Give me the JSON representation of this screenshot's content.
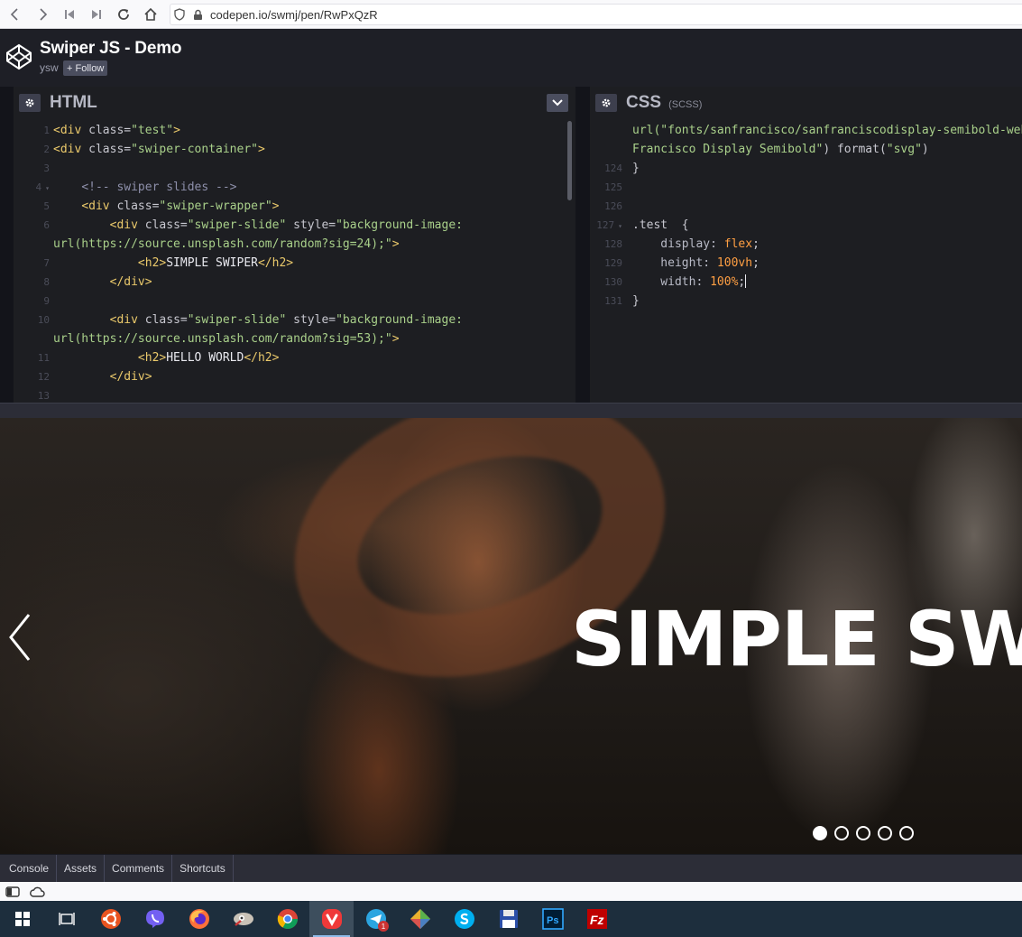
{
  "browser": {
    "url": "codepen.io/swmj/pen/RwPxQzR"
  },
  "pen": {
    "title": "Swiper JS - Demo",
    "author": "ysw",
    "follow_label": "+ Follow"
  },
  "html_editor": {
    "name": "HTML",
    "lines": [
      {
        "n": "1",
        "tokens": [
          [
            "tag",
            "<div "
          ],
          [
            "attr",
            "class="
          ],
          [
            "str",
            "\"test\""
          ],
          [
            "tag",
            ">"
          ]
        ]
      },
      {
        "n": "2",
        "tokens": [
          [
            "tag",
            "<div "
          ],
          [
            "attr",
            "class="
          ],
          [
            "str",
            "\"swiper-container\""
          ],
          [
            "tag",
            ">"
          ]
        ]
      },
      {
        "n": "3",
        "tokens": []
      },
      {
        "n": "4",
        "tokens": [
          [
            "txt",
            "    "
          ],
          [
            "com",
            "<!-- swiper slides -->"
          ]
        ]
      },
      {
        "n": "5",
        "tokens": [
          [
            "txt",
            "    "
          ],
          [
            "tag",
            "<div "
          ],
          [
            "attr",
            "class="
          ],
          [
            "str",
            "\"swiper-wrapper\""
          ],
          [
            "tag",
            ">"
          ]
        ]
      },
      {
        "n": "6",
        "tokens": [
          [
            "txt",
            "        "
          ],
          [
            "tag",
            "<div "
          ],
          [
            "attr",
            "class="
          ],
          [
            "str",
            "\"swiper-slide\""
          ],
          [
            "attr",
            " style="
          ],
          [
            "str",
            "\"background-image:"
          ]
        ]
      },
      {
        "n": "",
        "tokens": [
          [
            "str",
            "url(https://source.unsplash.com/random?sig=24);\""
          ],
          [
            "tag",
            ">"
          ]
        ]
      },
      {
        "n": "7",
        "tokens": [
          [
            "txt",
            "            "
          ],
          [
            "tag",
            "<h2>"
          ],
          [
            "txt",
            "SIMPLE SWIPER"
          ],
          [
            "tag",
            "</h2>"
          ]
        ]
      },
      {
        "n": "8",
        "tokens": [
          [
            "txt",
            "        "
          ],
          [
            "tag",
            "</div>"
          ]
        ]
      },
      {
        "n": "9",
        "tokens": []
      },
      {
        "n": "10",
        "tokens": [
          [
            "txt",
            "        "
          ],
          [
            "tag",
            "<div "
          ],
          [
            "attr",
            "class="
          ],
          [
            "str",
            "\"swiper-slide\""
          ],
          [
            "attr",
            " style="
          ],
          [
            "str",
            "\"background-image:"
          ]
        ]
      },
      {
        "n": "",
        "tokens": [
          [
            "str",
            "url(https://source.unsplash.com/random?sig=53);\""
          ],
          [
            "tag",
            ">"
          ]
        ]
      },
      {
        "n": "11",
        "tokens": [
          [
            "txt",
            "            "
          ],
          [
            "tag",
            "<h2>"
          ],
          [
            "txt",
            "HELLO WORLD"
          ],
          [
            "tag",
            "</h2>"
          ]
        ]
      },
      {
        "n": "12",
        "tokens": [
          [
            "txt",
            "        "
          ],
          [
            "tag",
            "</div>"
          ]
        ]
      },
      {
        "n": "13",
        "tokens": []
      }
    ]
  },
  "css_editor": {
    "name": "CSS",
    "sub": "(SCSS)",
    "lines": [
      {
        "n": "",
        "tokens": [
          [
            "str",
            "url(\"fonts/sanfrancisco/sanfranciscodisplay-semibold-webfont.svg#San"
          ]
        ]
      },
      {
        "n": "",
        "tokens": [
          [
            "str",
            "Francisco Display Semibold\""
          ],
          [
            "fn",
            ") format("
          ],
          [
            "str",
            "\"svg\""
          ],
          [
            "fn",
            ")"
          ]
        ]
      },
      {
        "n": "124",
        "tokens": [
          [
            "fn",
            "}"
          ]
        ]
      },
      {
        "n": "125",
        "tokens": []
      },
      {
        "n": "126",
        "tokens": []
      },
      {
        "n": "127",
        "tokens": [
          [
            "fn",
            ".test  {"
          ]
        ]
      },
      {
        "n": "128",
        "tokens": [
          [
            "prop",
            "    display: "
          ],
          [
            "val",
            "flex"
          ],
          [
            "fn",
            ";"
          ]
        ]
      },
      {
        "n": "129",
        "tokens": [
          [
            "prop",
            "    height: "
          ],
          [
            "num",
            "100vh"
          ],
          [
            "fn",
            ";"
          ]
        ]
      },
      {
        "n": "130",
        "tokens": [
          [
            "prop",
            "    width: "
          ],
          [
            "num",
            "100%"
          ],
          [
            "fn",
            ";"
          ]
        ]
      },
      {
        "n": "131",
        "tokens": [
          [
            "fn",
            "}"
          ]
        ]
      }
    ]
  },
  "preview": {
    "slide_title": "SIMPLE SWIPER",
    "pagination": {
      "count": 5,
      "active_index": 0
    }
  },
  "bottom_tabs": [
    "Console",
    "Assets",
    "Comments",
    "Shortcuts"
  ],
  "taskbar": {
    "telegram_badge": "1",
    "apps": [
      "start",
      "task-view",
      "ubuntu",
      "viber",
      "firefox",
      "gimp",
      "chrome",
      "vivaldi",
      "telegram",
      "git",
      "skype",
      "save",
      "photoshop",
      "filezilla"
    ],
    "active_app": "vivaldi"
  },
  "colors": {
    "codepen_dark": "#1e1f26",
    "tag": "#eac96b",
    "string": "#a9d08a",
    "comment": "#8d8faa",
    "number": "#ff9f43"
  }
}
